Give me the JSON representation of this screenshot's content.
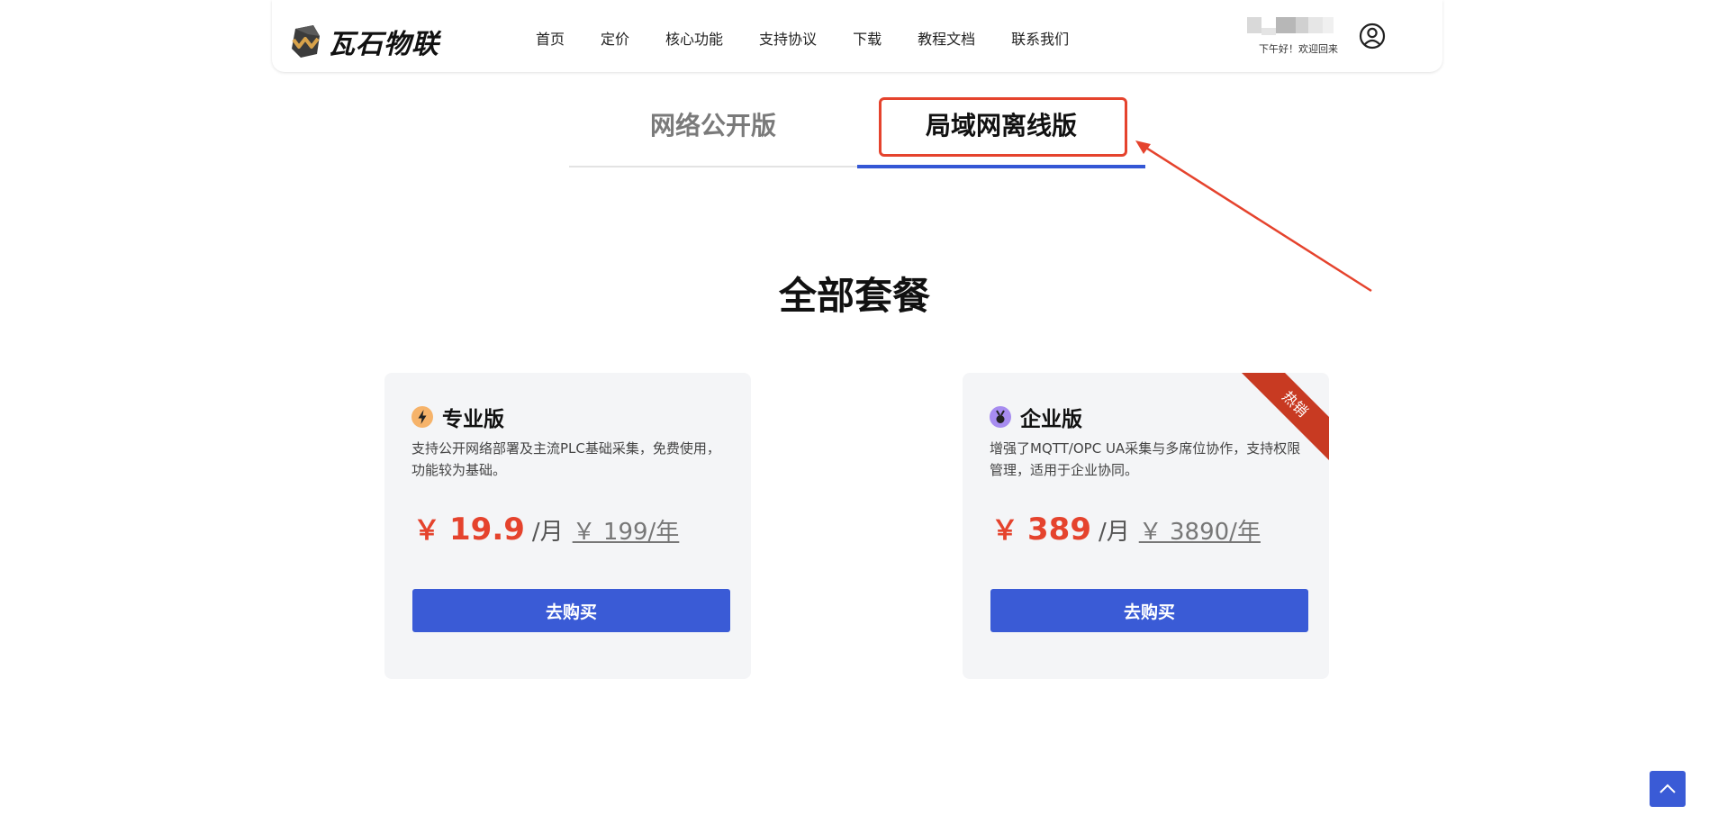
{
  "brand": {
    "name": "瓦石物联",
    "logo_icon": "rock-logo-icon"
  },
  "nav": {
    "items": [
      {
        "label": "首页"
      },
      {
        "label": "定价"
      },
      {
        "label": "核心功能"
      },
      {
        "label": "支持协议"
      },
      {
        "label": "下载"
      },
      {
        "label": "教程文档"
      },
      {
        "label": "联系我们"
      }
    ]
  },
  "user": {
    "greeting": "下午好！欢迎回来",
    "icon": "user-circle-icon"
  },
  "tabs": [
    {
      "label": "网络公开版",
      "active": false
    },
    {
      "label": "局域网离线版",
      "active": true
    }
  ],
  "section": {
    "title": "全部套餐"
  },
  "plans": [
    {
      "name": "专业版",
      "icon": "lightning-icon",
      "description": "支持公开网络部署及主流PLC基础采集，免费使用，功能较为基础。",
      "currency": "￥",
      "price": "19.9",
      "unit": "/月",
      "original": "￥ 199/年",
      "button": "去购买"
    },
    {
      "name": "企业版",
      "icon": "medal-icon",
      "description": "增强了MQTT/OPC UA采集与多席位协作，支持权限管理，适用于企业协同。",
      "currency": "￥",
      "price": "389",
      "unit": "/月",
      "original": "￥ 3890/年",
      "button": "去购买",
      "badge": "热销"
    }
  ],
  "colors": {
    "accent": "#3a5bd6",
    "price": "#e5432d",
    "annotation": "#e5432d",
    "ribbon": "#c83a22"
  },
  "back_to_top": {
    "icon": "chevron-up-icon"
  }
}
